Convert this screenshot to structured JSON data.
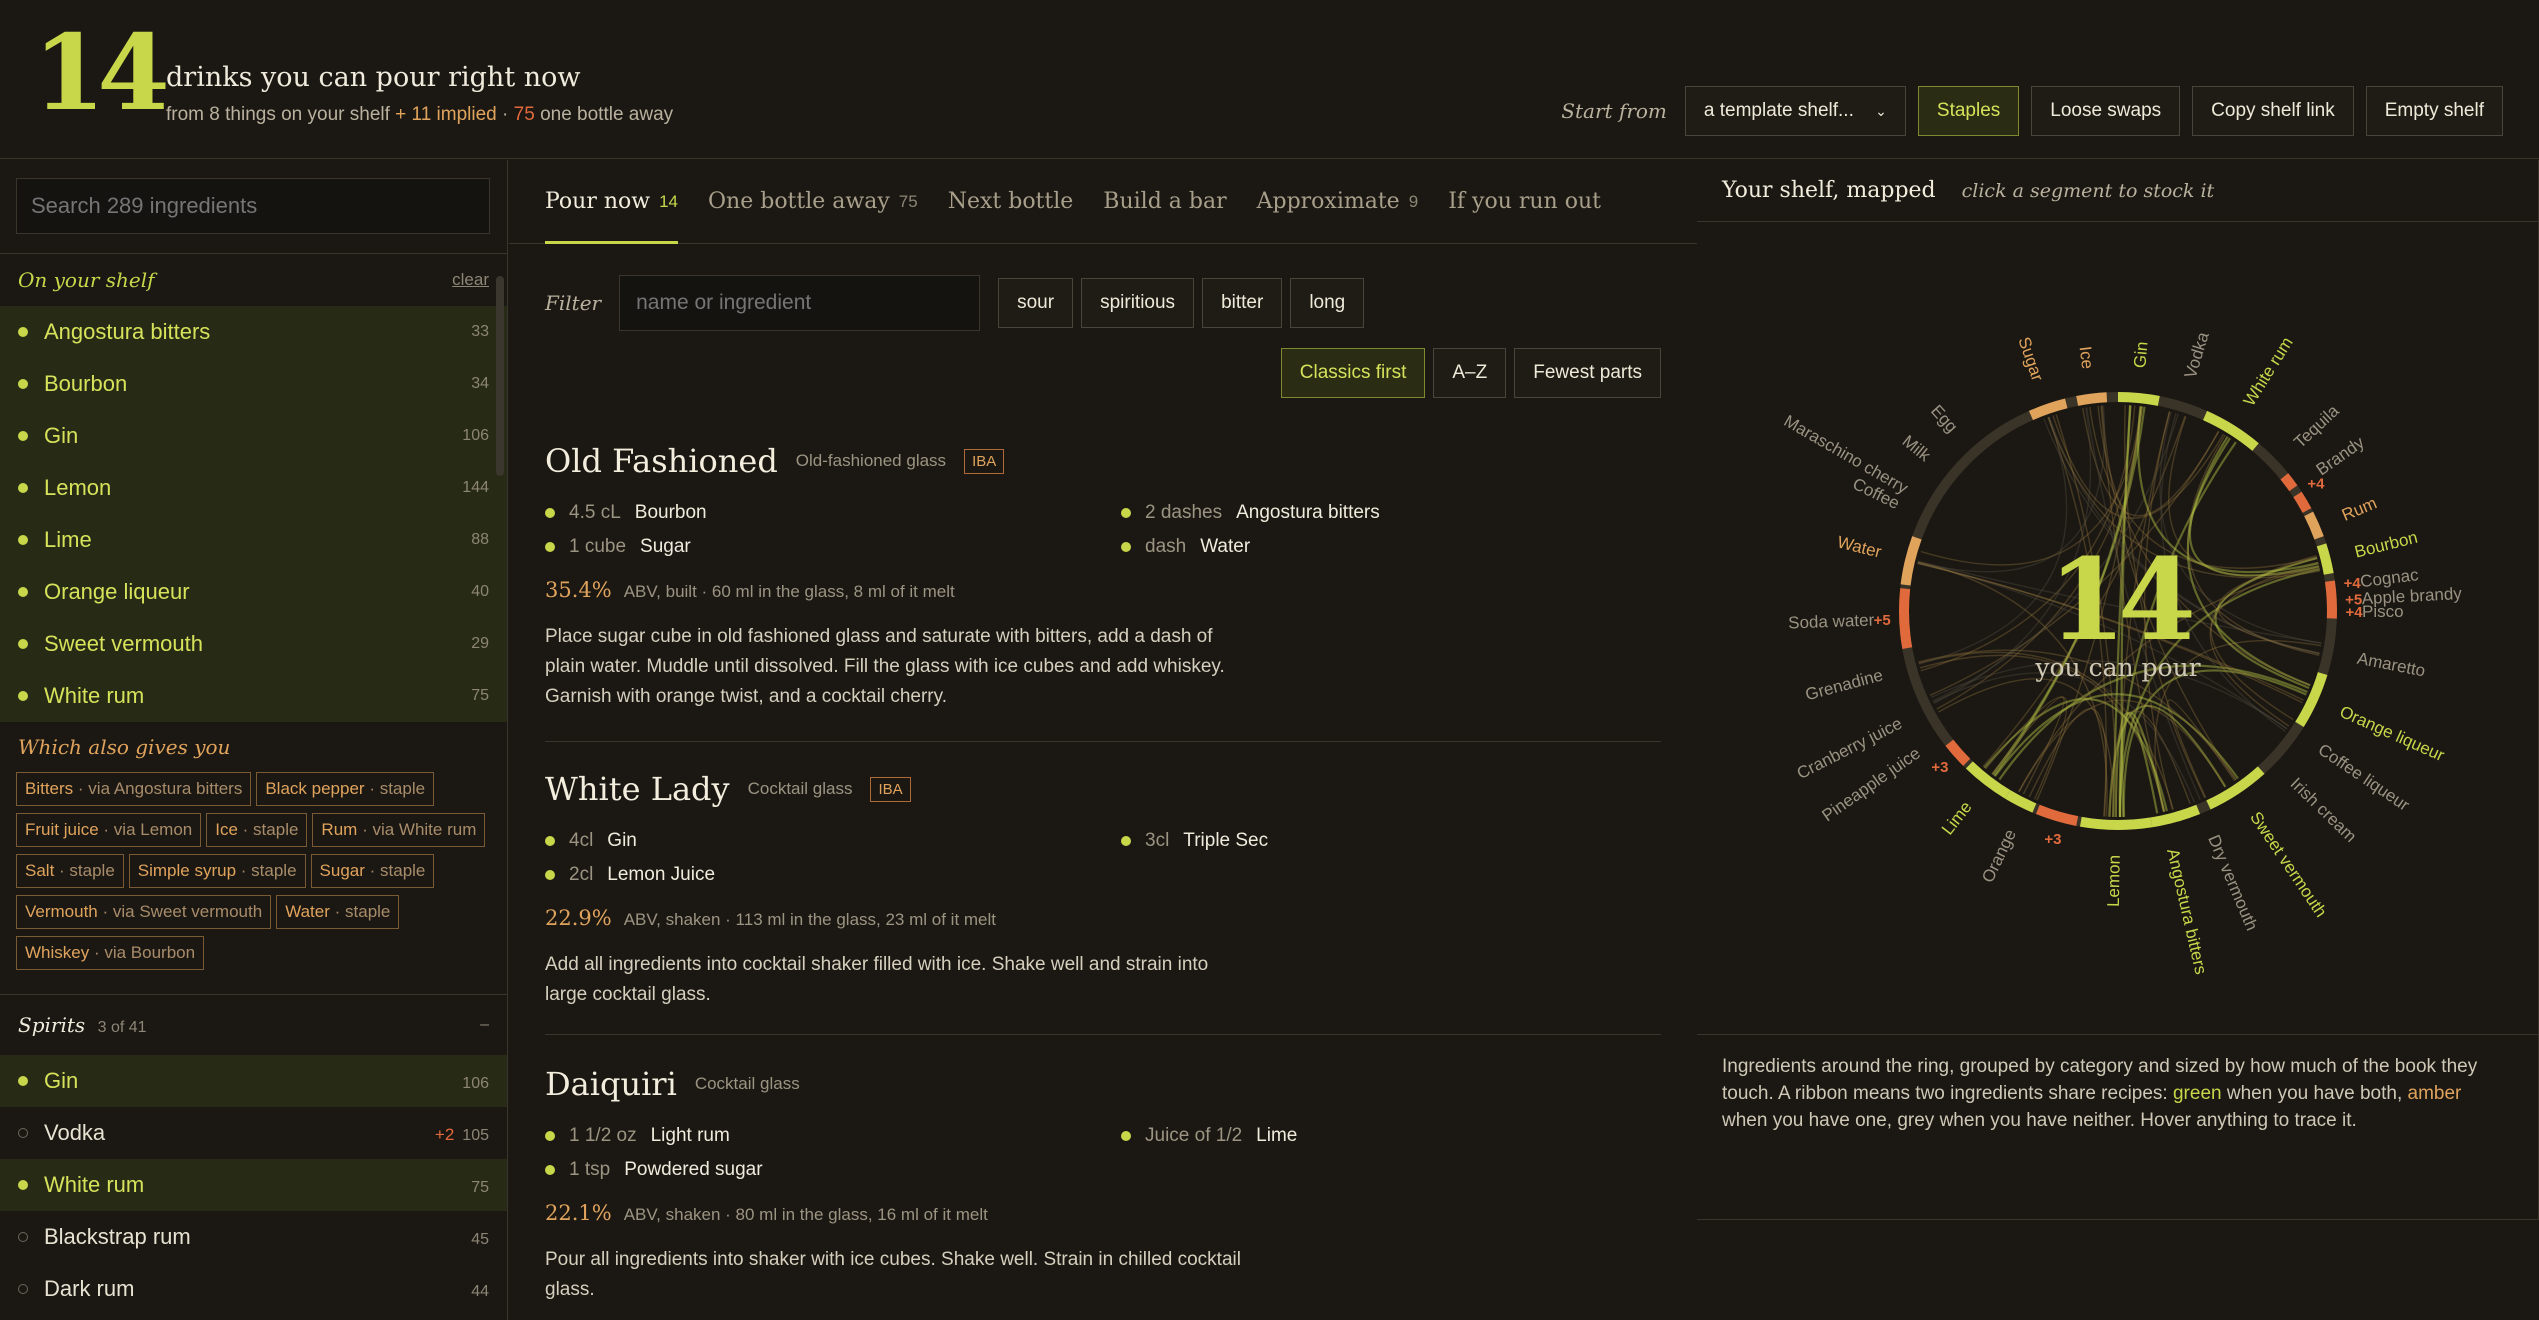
{
  "header": {
    "count": "14",
    "title": "drinks you can pour right now",
    "sub_prefix": "from 8 things on your shelf",
    "sub_implied": "+ 11 implied",
    "sub_sep": "·",
    "sub_away_n": "75",
    "sub_away_label": "one bottle away",
    "start_from": "Start from",
    "template_select": "a template shelf...",
    "buttons": [
      "Staples",
      "Loose swaps",
      "Copy shelf link",
      "Empty shelf"
    ]
  },
  "sidebar": {
    "search_placeholder": "Search 289 ingredients",
    "shelf_title": "On your shelf",
    "clear_label": "clear",
    "shelf_items": [
      {
        "label": "Angostura bitters",
        "count": "33"
      },
      {
        "label": "Bourbon",
        "count": "34"
      },
      {
        "label": "Gin",
        "count": "106"
      },
      {
        "label": "Lemon",
        "count": "144"
      },
      {
        "label": "Lime",
        "count": "88"
      },
      {
        "label": "Orange liqueur",
        "count": "40"
      },
      {
        "label": "Sweet vermouth",
        "count": "29"
      },
      {
        "label": "White rum",
        "count": "75"
      }
    ],
    "gives_title": "Which also gives you",
    "gives": [
      {
        "name": "Bitters",
        "via": "· via Angostura bitters"
      },
      {
        "name": "Black pepper",
        "via": "· staple"
      },
      {
        "name": "Fruit juice",
        "via": "· via Lemon"
      },
      {
        "name": "Ice",
        "via": "· staple"
      },
      {
        "name": "Rum",
        "via": "· via White rum"
      },
      {
        "name": "Salt",
        "via": "· staple"
      },
      {
        "name": "Simple syrup",
        "via": "· staple"
      },
      {
        "name": "Sugar",
        "via": "· staple"
      },
      {
        "name": "Vermouth",
        "via": "· via Sweet vermouth"
      },
      {
        "name": "Water",
        "via": "· staple"
      },
      {
        "name": "Whiskey",
        "via": "· via Bourbon"
      }
    ],
    "spirits_title": "Spirits",
    "spirits_count": "3 of 41",
    "spirits_toggle": "–",
    "spirits": [
      {
        "label": "Gin",
        "count": "106",
        "on": true,
        "extra": ""
      },
      {
        "label": "Vodka",
        "count": "105",
        "on": false,
        "extra": "+2"
      },
      {
        "label": "White rum",
        "count": "75",
        "on": true,
        "extra": ""
      },
      {
        "label": "Blackstrap rum",
        "count": "45",
        "on": false,
        "extra": ""
      },
      {
        "label": "Dark rum",
        "count": "44",
        "on": false,
        "extra": ""
      }
    ]
  },
  "main": {
    "tabs": [
      {
        "label": "Pour now",
        "n": "14"
      },
      {
        "label": "One bottle away",
        "n": "75"
      },
      {
        "label": "Next bottle",
        "n": ""
      },
      {
        "label": "Build a bar",
        "n": ""
      },
      {
        "label": "Approximate",
        "n": "9"
      },
      {
        "label": "If you run out",
        "n": ""
      }
    ],
    "filter_label": "Filter",
    "filter_placeholder": "name or ingredient",
    "filter_tags": [
      "sour",
      "spiritious",
      "bitter",
      "long"
    ],
    "sort": [
      "Classics first",
      "A–Z",
      "Fewest parts"
    ],
    "recipes": [
      {
        "name": "Old Fashioned",
        "glass": "Old-fashioned glass",
        "iba": "IBA",
        "ings": [
          {
            "q": "4.5 cL",
            "n": "Bourbon"
          },
          {
            "q": "2 dashes",
            "n": "Angostura bitters"
          },
          {
            "q": "1 cube",
            "n": "Sugar"
          },
          {
            "q": "dash",
            "n": "Water"
          }
        ],
        "abv": "35.4%",
        "abv_text": "ABV, built · 60 ml in the glass, 8 ml of it melt",
        "desc": "Place sugar cube in old fashioned glass and saturate with bitters, add a dash of plain water. Muddle until dissolved. Fill the glass with ice cubes and add whiskey. Garnish with orange twist, and a cocktail cherry."
      },
      {
        "name": "White Lady",
        "glass": "Cocktail glass",
        "iba": "IBA",
        "ings": [
          {
            "q": "4cl",
            "n": "Gin"
          },
          {
            "q": "3cl",
            "n": "Triple Sec"
          },
          {
            "q": "2cl",
            "n": "Lemon Juice"
          }
        ],
        "abv": "22.9%",
        "abv_text": "ABV, shaken · 113 ml in the glass, 23 ml of it melt",
        "desc": "Add all ingredients into cocktail shaker filled with ice. Shake well and strain into large cocktail glass."
      },
      {
        "name": "Daiquiri",
        "glass": "Cocktail glass",
        "iba": "",
        "ings": [
          {
            "q": "1 1/2 oz",
            "n": "Light rum"
          },
          {
            "q": "Juice of 1/2",
            "n": "Lime"
          },
          {
            "q": "1 tsp",
            "n": "Powdered sugar"
          }
        ],
        "abv": "22.1%",
        "abv_text": "ABV, shaken · 80 ml in the glass, 16 ml of it melt",
        "desc": "Pour all ingredients into shaker with ice cubes. Shake well. Strain in chilled cocktail glass."
      }
    ]
  },
  "map": {
    "title": "Your shelf, mapped",
    "hint": "click a segment to stock it",
    "center_count": "14",
    "center_label": "you can pour",
    "labels": [
      {
        "t": "Maraschino cherry",
        "a": -60,
        "s": "off"
      },
      {
        "t": "Sugar",
        "a": -19,
        "s": "amber"
      },
      {
        "t": "Ice",
        "a": -7,
        "s": "amber"
      },
      {
        "t": "Gin",
        "a": 5,
        "s": "on"
      },
      {
        "t": "Vodka",
        "a": 17,
        "s": "off"
      },
      {
        "t": "White rum",
        "a": 32,
        "s": "on"
      },
      {
        "t": "Tequila",
        "a": 47,
        "s": "off"
      },
      {
        "t": "Brandy",
        "a": 55,
        "s": "off"
      },
      {
        "t": "+4",
        "a": 57,
        "s": "red"
      },
      {
        "t": "Rum",
        "a": 67,
        "s": "amber"
      },
      {
        "t": "Bourbon",
        "a": 76,
        "s": "on"
      },
      {
        "t": "+4",
        "a": 83,
        "s": "red"
      },
      {
        "t": "Cognac",
        "a": 83,
        "s": "off"
      },
      {
        "t": "+5",
        "a": 87,
        "s": "red"
      },
      {
        "t": "Apple brandy",
        "a": 87,
        "s": "off"
      },
      {
        "t": "+4",
        "a": 90,
        "s": "red"
      },
      {
        "t": "Pisco",
        "a": 90,
        "s": "off"
      },
      {
        "t": "Amaretto",
        "a": 101,
        "s": "off"
      },
      {
        "t": "Orange liqueur",
        "a": 114,
        "s": "on"
      },
      {
        "t": "Coffee liqueur",
        "a": 124,
        "s": "off"
      },
      {
        "t": "Irish cream",
        "a": 134,
        "s": "off"
      },
      {
        "t": "Sweet vermouth",
        "a": 146,
        "s": "on"
      },
      {
        "t": "Dry vermouth",
        "a": 157,
        "s": "off"
      },
      {
        "t": "Angostura bitters",
        "a": 167,
        "s": "on"
      },
      {
        "t": "Lemon",
        "a": 181,
        "s": "on"
      },
      {
        "t": "+3",
        "a": 196,
        "s": "red"
      },
      {
        "t": "Orange",
        "a": 206,
        "s": "off"
      },
      {
        "t": "Lime",
        "a": 218,
        "s": "on"
      },
      {
        "t": "+3",
        "a": 229,
        "s": "red"
      },
      {
        "t": "Pineapple juice",
        "a": 235,
        "s": "off"
      },
      {
        "t": "Cranberry juice",
        "a": 243,
        "s": "off"
      },
      {
        "t": "Grenadine",
        "a": 255,
        "s": "off"
      },
      {
        "t": "+5",
        "a": 268,
        "s": "red"
      },
      {
        "t": "Soda water",
        "a": 268,
        "s": "off"
      },
      {
        "t": "Water",
        "a": 284,
        "s": "amber"
      },
      {
        "t": "Coffee",
        "a": 296,
        "s": "off"
      },
      {
        "t": "Milk",
        "a": 309,
        "s": "off"
      },
      {
        "t": "Egg",
        "a": 318,
        "s": "off"
      }
    ],
    "note_1": "Ingredients around the ring, grouped by category and sized by how much of the book they touch. A ribbon means two ingredients share recipes:",
    "note_green": "green",
    "note_2": "when you have both,",
    "note_amber": "amber",
    "note_3": "when you have one, grey when you have neither. Hover anything to trace it.",
    "colors": {
      "on": "#c8d64a",
      "amber": "#e0a35c",
      "red": "#e06a3c",
      "off": "#9a9282"
    }
  }
}
